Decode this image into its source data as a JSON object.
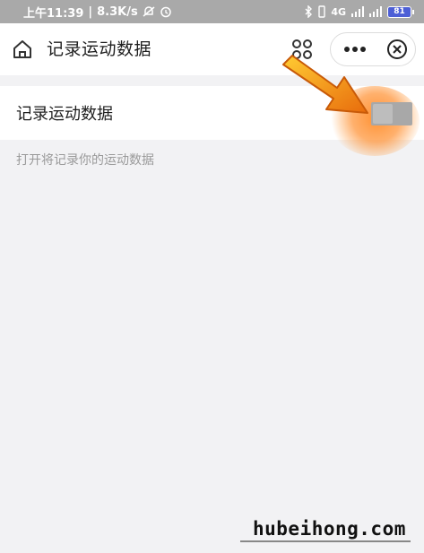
{
  "status_bar": {
    "time_text": "上午11:39",
    "speed_text": "8.3K/s",
    "network_text": "4G",
    "battery_text": "81"
  },
  "nav_bar": {
    "title": "记录运动数据"
  },
  "setting": {
    "label": "记录运动数据",
    "toggle_on": false
  },
  "hint_text": "打开将记录你的运动数据",
  "watermark": "hubeihong.com",
  "colors": {
    "status_bar_bg": "#a9a9a9",
    "page_bg": "#f2f2f4",
    "toggle_off": "#a8a8a8",
    "annotation_arrow": "#f28c1c",
    "battery_fill": "#4d5fd6"
  },
  "icons": [
    "home-icon",
    "apps-icon",
    "more-icon",
    "close-icon",
    "mute-icon",
    "alarm-icon",
    "bluetooth-icon",
    "signal-icon",
    "battery-icon",
    "arrow-annotation"
  ]
}
